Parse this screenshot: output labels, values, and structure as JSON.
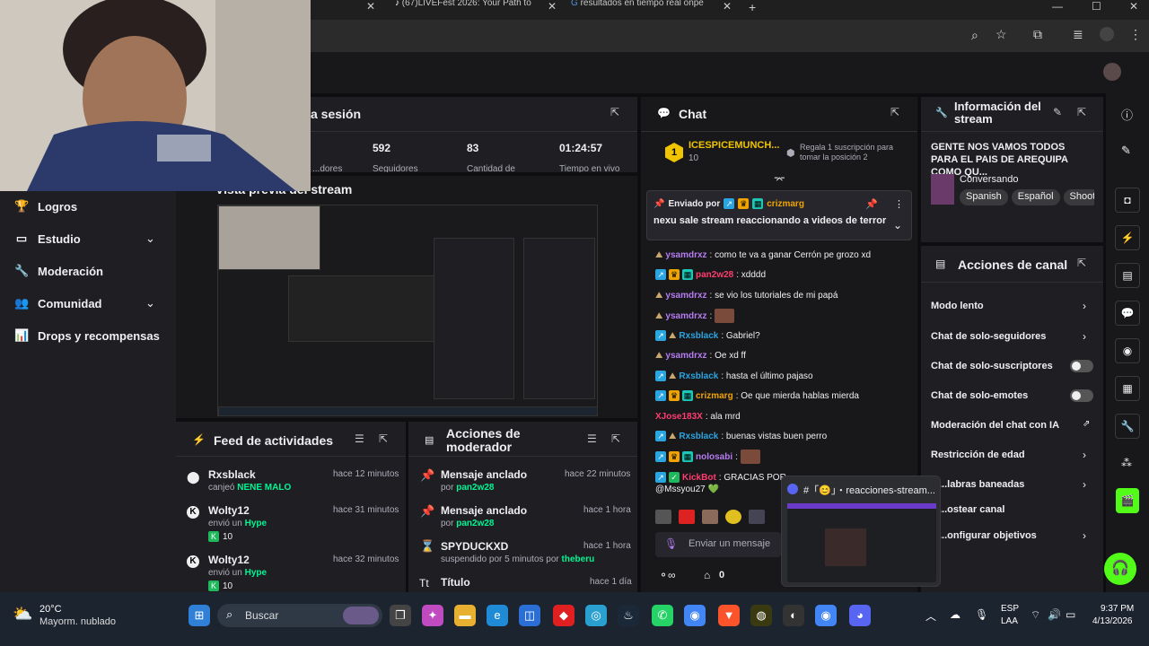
{
  "browser": {
    "tabs": [
      {
        "title": "(67)LIVEFest 2026: Your Path to"
      },
      {
        "title": "resultados en tiempo real onpe"
      }
    ],
    "new_tab": "+"
  },
  "sidebar": {
    "items": [
      {
        "label": "Logros",
        "icon": "trophy-icon"
      },
      {
        "label": "Estudio",
        "icon": "studio-icon"
      },
      {
        "label": "Moderación",
        "icon": "wrench-icon"
      },
      {
        "label": "Comunidad",
        "icon": "community-icon"
      },
      {
        "label": "Drops y recompensas",
        "icon": "drops-icon"
      }
    ]
  },
  "session": {
    "title_fragment": "a sesión",
    "stats": [
      "592",
      "83",
      "01:24:57"
    ],
    "stat_labels": [
      "...dores",
      "Seguidores",
      "Cantidad de",
      "Tiempo en vivo"
    ]
  },
  "preview": {
    "title": "Vista previa del stream"
  },
  "feed": {
    "title": "Feed de actividades",
    "items": [
      {
        "name": "Rxsblack",
        "sub_prefix": "canjeó",
        "sub_highlight": "NENE MALO",
        "time": "hace 12 minutos",
        "amount": ""
      },
      {
        "name": "Wolty12",
        "sub_prefix": "envió un",
        "sub_highlight": "Hype",
        "time": "hace 31 minutos",
        "amount": "10"
      },
      {
        "name": "Wolty12",
        "sub_prefix": "envió un",
        "sub_highlight": "Hype",
        "time": "hace 32 minutos",
        "amount": "10"
      }
    ]
  },
  "modactions": {
    "title": "Acciones de moderador",
    "items": [
      {
        "title": "Mensaje anclado",
        "sub_prefix": "por",
        "sub_user": "pan2w28",
        "time": "hace 22 minutos"
      },
      {
        "title": "Mensaje anclado",
        "sub_prefix": "por",
        "sub_user": "pan2w28",
        "time": "hace 1 hora"
      },
      {
        "title": "SPYDUCKXD",
        "sub_prefix": "suspendido por 5 minutos por",
        "sub_user": "theberu",
        "time": "hace 1 hora"
      },
      {
        "title": "Título",
        "sub_prefix": "",
        "sub_user": "",
        "time": "hace 1 día"
      }
    ]
  },
  "chat": {
    "title": "Chat",
    "top_user": "ICESPICEMUNCH...",
    "top_count": "10",
    "gift_text": "Regala 1 suscripción para tomar la posición 2",
    "pinned_by_label": "Enviado por",
    "pinned_user": "crizmarg",
    "pinned_text": "nexu sale stream reaccionando a videos de terror",
    "messages": [
      {
        "user": "ysamdrxz",
        "color": "#b57cf0",
        "text": ": como te va a ganar Cerrón pe grozo xd"
      },
      {
        "user": "pan2w28",
        "color": "#ff3c6f",
        "text": ": xdddd"
      },
      {
        "user": "ysamdrxz",
        "color": "#b57cf0",
        "text": ": se vio los tutoriales de mi papá"
      },
      {
        "user": "ysamdrxz",
        "color": "#b57cf0",
        "text": ":"
      },
      {
        "user": "Rxsblack",
        "color": "#2aa5e0",
        "text": ": Gabriel?"
      },
      {
        "user": "ysamdrxz",
        "color": "#b57cf0",
        "text": ": Oe xd ff"
      },
      {
        "user": "Rxsblack",
        "color": "#2aa5e0",
        "text": ": hasta el último pajaso"
      },
      {
        "user": "crizmarg",
        "color": "#f0a400",
        "text": ": Oe que mierda hablas mierda"
      },
      {
        "user": "XJose183X",
        "color": "#ff3c6f",
        "text": ": ala mrd"
      },
      {
        "user": "Rxsblack",
        "color": "#2aa5e0",
        "text": ": buenas vistas buen perro"
      },
      {
        "user": "nolosabi",
        "color": "#b57cf0",
        "text": ":"
      },
      {
        "user": "KickBot",
        "color": "#ff3c6f",
        "text": ": GRACIAS POR"
      }
    ],
    "last_line": "@Mssyou27",
    "input_placeholder": "Enviar un mensaje",
    "footer_count": "0"
  },
  "streaminfo": {
    "title": "Información del stream",
    "stream_title": "GENTE NOS VAMOS TODOS PARA EL PAIS DE AREQUIPA COMO QU...",
    "category": "Conversando",
    "tags": [
      "Spanish",
      "Español",
      "Shoot"
    ]
  },
  "channel_actions": {
    "title": "Acciones de canal",
    "items": [
      {
        "label": "Modo lento",
        "control": "chevron"
      },
      {
        "label": "Chat de solo-seguidores",
        "control": "chevron"
      },
      {
        "label": "Chat de solo-suscriptores",
        "control": "toggle"
      },
      {
        "label": "Chat de solo-emotes",
        "control": "toggle"
      },
      {
        "label": "Moderación del chat con IA",
        "control": "external"
      },
      {
        "label": "Restricción de edad",
        "control": "chevron"
      },
      {
        "label": "...labras baneadas",
        "control": "chevron"
      },
      {
        "label": "...ostear canal",
        "control": "none"
      },
      {
        "label": "...onfigurar objetivos",
        "control": "chevron"
      }
    ]
  },
  "discord_popup": {
    "title": "#「😊」・reacciones-stream..."
  },
  "taskbar": {
    "weather_temp": "20°C",
    "weather_desc": "Mayorm. nublado",
    "search_label": "Buscar",
    "lang1": "ESP",
    "lang2": "LAA",
    "time": "9:37 PM",
    "date": "4/13/2026"
  },
  "colors": {
    "accent": "#53fc18",
    "purple": "#b57cf0"
  }
}
